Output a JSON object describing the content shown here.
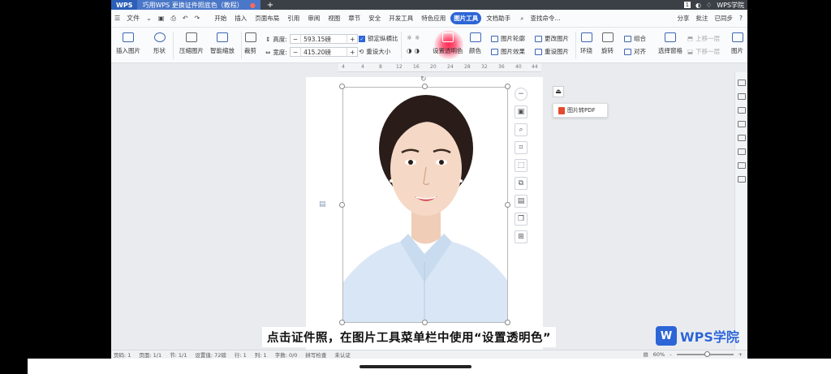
{
  "tabbar": {
    "app": "WPS",
    "doc_tab": "巧用WPS 更换证件照底色（教程）",
    "plus": "+",
    "right_badge": "1",
    "right_brand": "WPS学院"
  },
  "menubar": {
    "file": "文件",
    "tabs": [
      "开始",
      "插入",
      "页面布局",
      "引用",
      "审阅",
      "视图",
      "章节",
      "安全",
      "开发工具",
      "特色应用",
      "图片工具",
      "文档助手"
    ],
    "active_tab": "图片工具",
    "search": "查找命令...",
    "share": "分享",
    "annotate": "批注",
    "sync": "已同步",
    "help": "?"
  },
  "ribbon": {
    "insert_image": "插入图片",
    "shape": "形状",
    "compress": "压缩图片",
    "smart_zoom": "智能缩放",
    "crop": "裁剪",
    "height_label": "高度:",
    "height_value": "593.15磅",
    "width_label": "宽度:",
    "width_value": "415.20磅",
    "lock_ratio": "锁定纵横比",
    "reset_size": "重设大小",
    "set_transparent": "设置透明色",
    "color": "颜色",
    "picture_outline": "图片轮廓",
    "change_picture": "更改图片",
    "picture_effect": "图片效果",
    "reset_picture": "重设图片",
    "wrap": "环绕",
    "rotate": "旋转",
    "combine": "组合",
    "align": "对齐",
    "select_pane": "选择窗格",
    "move_up": "上移一层",
    "move_down": "下移一层",
    "picture_extra": "图片"
  },
  "ruler": {
    "ticks": [
      "4",
      "4",
      "8",
      "12",
      "16",
      "20",
      "24",
      "28",
      "32",
      "36",
      "40",
      "44"
    ]
  },
  "popup": {
    "label": "图片转PDF"
  },
  "subtitle": "点击证件照，在图片工具菜单栏中使用“设置透明色”",
  "logo": {
    "mark": "W",
    "text": "WPS学院"
  },
  "statusbar": {
    "page": "页码: 1",
    "pages": "页面: 1/1",
    "section": "节: 1/1",
    "setting": "设置值: 72磅",
    "row": "行: 1",
    "col": "列: 1",
    "chars": "字数: 0/0",
    "spell": "拼写检查",
    "cert": "未认证",
    "zoom": "60%",
    "minus": "-",
    "plus": "+"
  },
  "colors": {
    "accent": "#2c65d6",
    "highlight": "#ff2a55",
    "tabbar": "#3b3f46"
  }
}
